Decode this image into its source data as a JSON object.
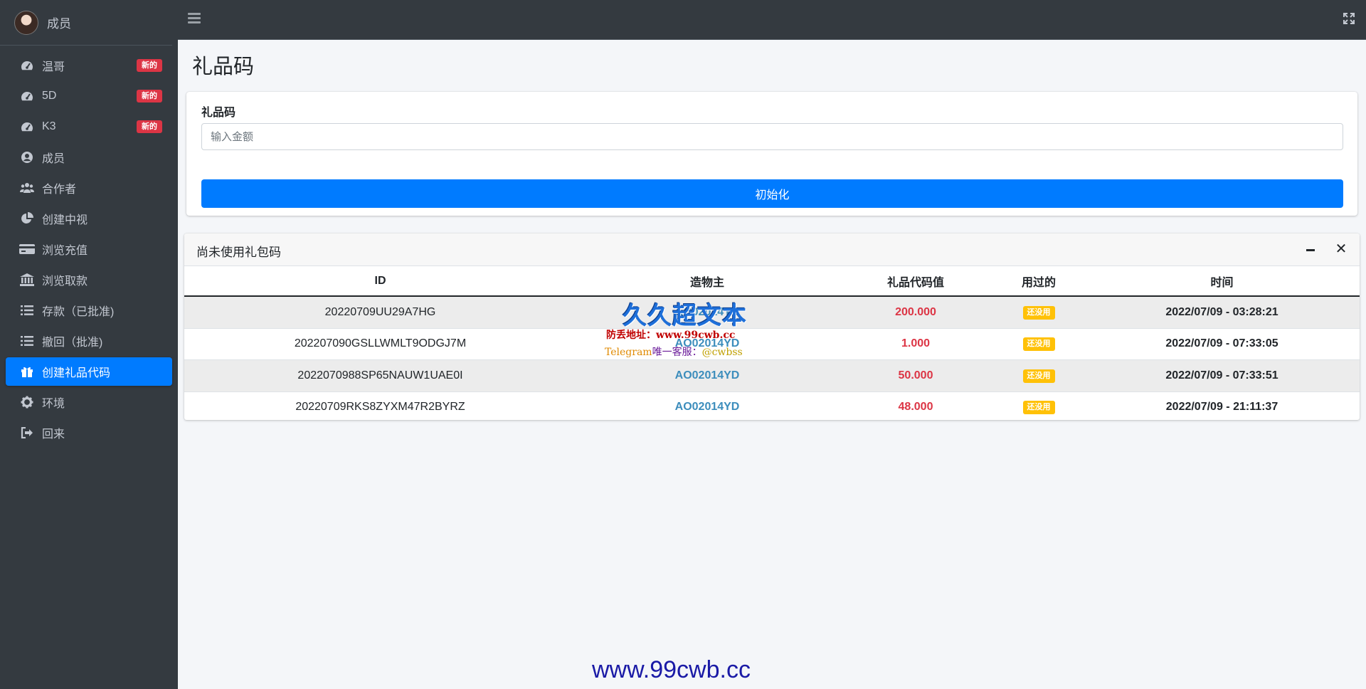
{
  "user": {
    "name": "成员"
  },
  "sidebar": {
    "items": [
      {
        "label": "温哥",
        "icon": "tachometer-icon",
        "badge": "新的"
      },
      {
        "label": "5D",
        "icon": "tachometer-icon",
        "badge": "新的"
      },
      {
        "label": "K3",
        "icon": "tachometer-icon",
        "badge": "新的"
      },
      {
        "label": "成员",
        "icon": "user-circle-icon"
      },
      {
        "label": "合作者",
        "icon": "users-icon"
      },
      {
        "label": "创建中视",
        "icon": "pie-chart-icon"
      },
      {
        "label": "浏览充值",
        "icon": "credit-card-icon"
      },
      {
        "label": "浏览取款",
        "icon": "bank-icon"
      },
      {
        "label": "存款（已批准)",
        "icon": "list-icon"
      },
      {
        "label": "撤回（批准)",
        "icon": "list-icon"
      },
      {
        "label": "创建礼品代码",
        "icon": "gift-icon",
        "active": true
      },
      {
        "label": "环境",
        "icon": "gear-icon"
      },
      {
        "label": "回来",
        "icon": "sign-out-icon"
      }
    ]
  },
  "page": {
    "title": "礼品码"
  },
  "form": {
    "label": "礼品码",
    "placeholder": "输入金额",
    "submit_label": "初始化"
  },
  "table_card": {
    "title": "尚未使用礼包码",
    "columns": [
      "ID",
      "造物主",
      "礼品代码值",
      "用过的",
      "时间"
    ],
    "rows": [
      {
        "id": "20220709UU29A7HG",
        "creator": "AO02014YD",
        "value": "200.000",
        "used": "还没用",
        "time": "2022/07/09 - 03:28:21"
      },
      {
        "id": "202207090GSLLWMLT9ODGJ7M",
        "creator": "AO02014YD",
        "value": "1.000",
        "used": "还没用",
        "time": "2022/07/09 - 07:33:05"
      },
      {
        "id": "2022070988SP65NAUW1UAE0I",
        "creator": "AO02014YD",
        "value": "50.000",
        "used": "还没用",
        "time": "2022/07/09 - 07:33:51"
      },
      {
        "id": "20220709RKS8ZYXM47R2BYRZ",
        "creator": "AO02014YD",
        "value": "48.000",
        "used": "还没用",
        "time": "2022/07/09 - 21:11:37"
      }
    ]
  },
  "watermark": {
    "logo": "久久超文本",
    "line1": "防丢地址：www.99cwb.cc",
    "telegram": "Telegram",
    "contact": "唯一客服：",
    "handle": "@cwbss",
    "bottom": "www.99cwb.cc"
  },
  "colors": {
    "sidebar_bg": "#343a40",
    "active": "#007bff",
    "badge_new": "#dc3545",
    "badge_used": "#ffc107",
    "value_red": "#dc3545",
    "creator_blue": "#3c8dbc"
  }
}
